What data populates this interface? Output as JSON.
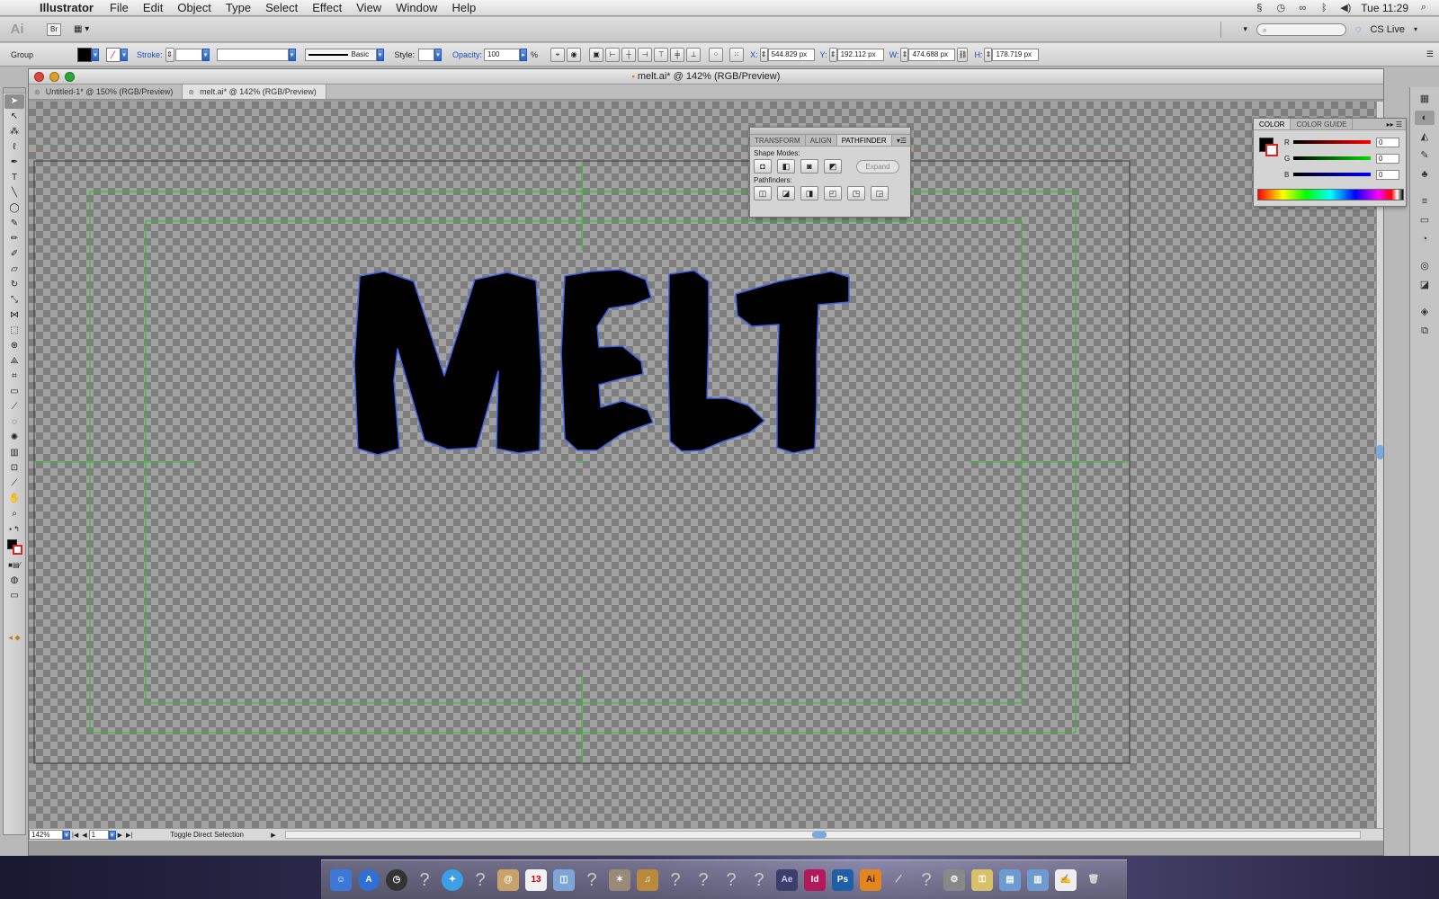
{
  "menubar": {
    "app_name": "Illustrator",
    "items": [
      "File",
      "Edit",
      "Object",
      "Type",
      "Select",
      "Effect",
      "View",
      "Window",
      "Help"
    ],
    "clock": "Tue 11:29"
  },
  "appbar": {
    "logo": "Ai",
    "bridge": "Br",
    "cs_live": "CS Live"
  },
  "controlbar": {
    "selection_type": "Group",
    "stroke_label": "Stroke:",
    "brush_label": "Basic",
    "style_label": "Style:",
    "opacity_label": "Opacity:",
    "opacity_value": "100",
    "opacity_unit": "%",
    "x_label": "X:",
    "x_value": "544.829 px",
    "y_label": "Y:",
    "y_value": "192.112 px",
    "w_label": "W:",
    "w_value": "474.688 px",
    "h_label": "H:",
    "h_value": "178.719 px"
  },
  "document": {
    "window_title": "melt.ai* @ 142% (RGB/Preview)",
    "tabs": [
      {
        "label": "Untitled-1* @ 150% (RGB/Preview)"
      },
      {
        "label": "melt.ai* @ 142% (RGB/Preview)"
      }
    ],
    "artwork_text": "MELT",
    "zoom": "142%",
    "page": "1",
    "status": "Toggle Direct Selection"
  },
  "pathfinder_panel": {
    "tabs": [
      "TRANSFORM",
      "ALIGN",
      "PATHFINDER"
    ],
    "shape_modes_label": "Shape Modes:",
    "pathfinders_label": "Pathfinders:",
    "expand_label": "Expand"
  },
  "color_panel": {
    "tabs": [
      "COLOR",
      "COLOR GUIDE"
    ],
    "channels": [
      {
        "label": "R",
        "value": "0"
      },
      {
        "label": "G",
        "value": "0"
      },
      {
        "label": "B",
        "value": "0"
      }
    ]
  },
  "colors": {
    "guide_green": "#22c51f",
    "path_blue": "#3d62e8",
    "accent_blue": "#2d63c5"
  },
  "icons": {
    "tools": [
      "selection-tool",
      "direct-selection-tool",
      "magic-wand-tool",
      "lasso-tool",
      "pen-tool",
      "type-tool",
      "line-tool",
      "ellipse-tool",
      "paintbrush-tool",
      "pencil-tool",
      "blob-brush-tool",
      "eraser-tool",
      "rotate-tool",
      "scale-tool",
      "width-tool",
      "free-transform-tool",
      "shape-builder-tool",
      "perspective-grid-tool",
      "mesh-tool",
      "gradient-tool",
      "eyedropper-tool",
      "blend-tool",
      "symbol-sprayer-tool",
      "column-graph-tool",
      "artboard-tool",
      "slice-tool",
      "hand-tool",
      "zoom-tool"
    ]
  }
}
